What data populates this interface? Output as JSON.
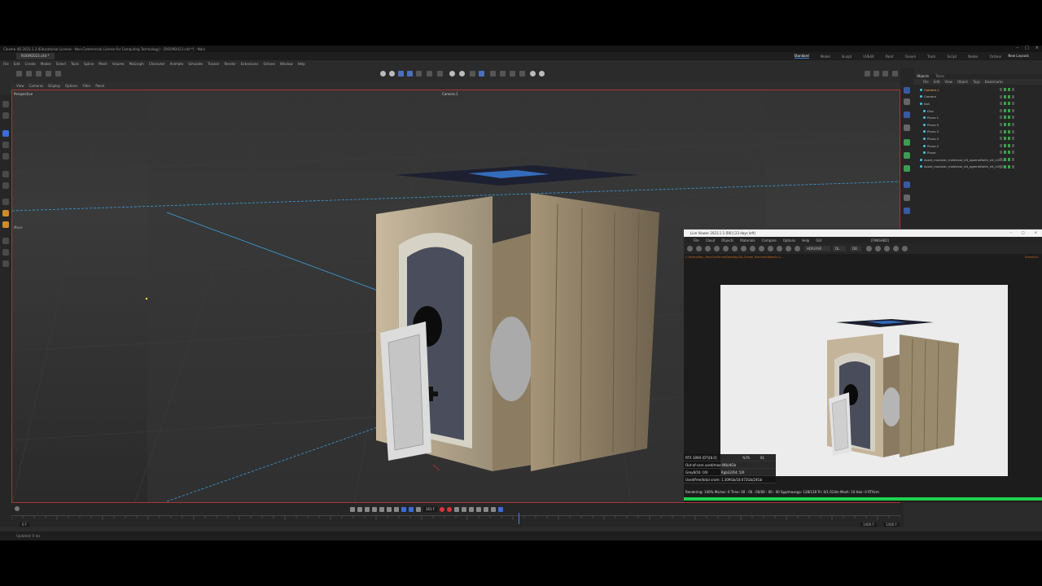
{
  "window": {
    "title": "Cinema 4D 2023.1.3 (Educational License - Non-Commercial License for Computing Technology) - [ROOM2023.c4d *] - Main",
    "document_tab": "ROOM2023.c4d *"
  },
  "layouts": [
    "Standard",
    "Model",
    "Sculpt",
    "UVEdit",
    "Paint",
    "Groom",
    "Track",
    "Script",
    "Nodes",
    "Octane"
  ],
  "layout_active": "Standard",
  "new_layouts": "New Layouts",
  "menu": [
    "File",
    "Edit",
    "Create",
    "Modes",
    "Select",
    "Tools",
    "Spline",
    "Mesh",
    "Volume",
    "MoGraph",
    "Character",
    "Animate",
    "Simulate",
    "Tracker",
    "Render",
    "Extensions",
    "Octane",
    "Window",
    "Help"
  ],
  "viewport_menu": [
    "View",
    "Cameras",
    "Display",
    "Options",
    "Filter",
    "Panel"
  ],
  "viewport": {
    "label": "Perspective",
    "camera": "Camera.1",
    "move_label": "Move"
  },
  "objects": {
    "tabs": [
      "Objects",
      "Takes"
    ],
    "menu": [
      "File",
      "Edit",
      "View",
      "Object",
      "Tags",
      "Bookmarks"
    ],
    "items": [
      {
        "name": "Camera.1",
        "selected": true
      },
      {
        "name": "Camera",
        "selected": false
      },
      {
        "name": "Null",
        "selected": false
      },
      {
        "name": "Disc",
        "selected": false
      },
      {
        "name": "Plane.1",
        "selected": false
      },
      {
        "name": "Plane.5",
        "selected": false
      },
      {
        "name": "Plane.4",
        "selected": false
      },
      {
        "name": "Plane.3",
        "selected": false
      },
      {
        "name": "Plane.2",
        "selected": false
      },
      {
        "name": "Plane",
        "selected": false
      },
      {
        "name": "Asset_modular_medieval_kit_agemettalle_kit_LOD0",
        "selected": false
      },
      {
        "name": "Asset_modular_medieval_kit_agemettalle_kit_LOD0",
        "selected": false
      }
    ]
  },
  "timeline": {
    "current_frame": "161 F",
    "start": "0 F",
    "end": "1400 F",
    "end2": "1400 F"
  },
  "status": "Updated: 0 ms",
  "octane": {
    "title": "Live Viewer 2023.1.1-[R6] [23 days left]",
    "menu": [
      "File",
      "Cloud",
      "Objects",
      "Materials",
      "Compare",
      "Options",
      "Help",
      "GUI"
    ],
    "status": "[FINISHED]",
    "kernel": "HDR/ASR",
    "channel": "DL",
    "preset": "DB",
    "path": "C:/Users/Ray_Mac/OneDrive/Desktop/3D_Scene_Textures/Wanda-1/...",
    "path_right": "Scene/tc1",
    "stats": [
      {
        "label": "RTX 3090 (DT)[8.0]",
        "v1": "%76",
        "v2": "61"
      },
      {
        "label": "Out-of-core used/max:0Kb/4Gb",
        "v1": "",
        "v2": ""
      },
      {
        "label": "Grey8/16: 0/0",
        "v1": "",
        "v2": "Rgb32/64: 5/0"
      },
      {
        "label": "Used/free/total vram: 1.309Gb/18.672Gb/24Gb",
        "v1": "",
        "v2": ""
      }
    ],
    "bottom": "Rendering: 100%  Ms/sec: 0    Time: 00 : 00 : 00/00 : 00 : 00    Spp/maxspp: 128/128    Tri: 0/1.014m    Mesh: 10    Hair: 0    RTXcm",
    "progress": 1.0
  }
}
